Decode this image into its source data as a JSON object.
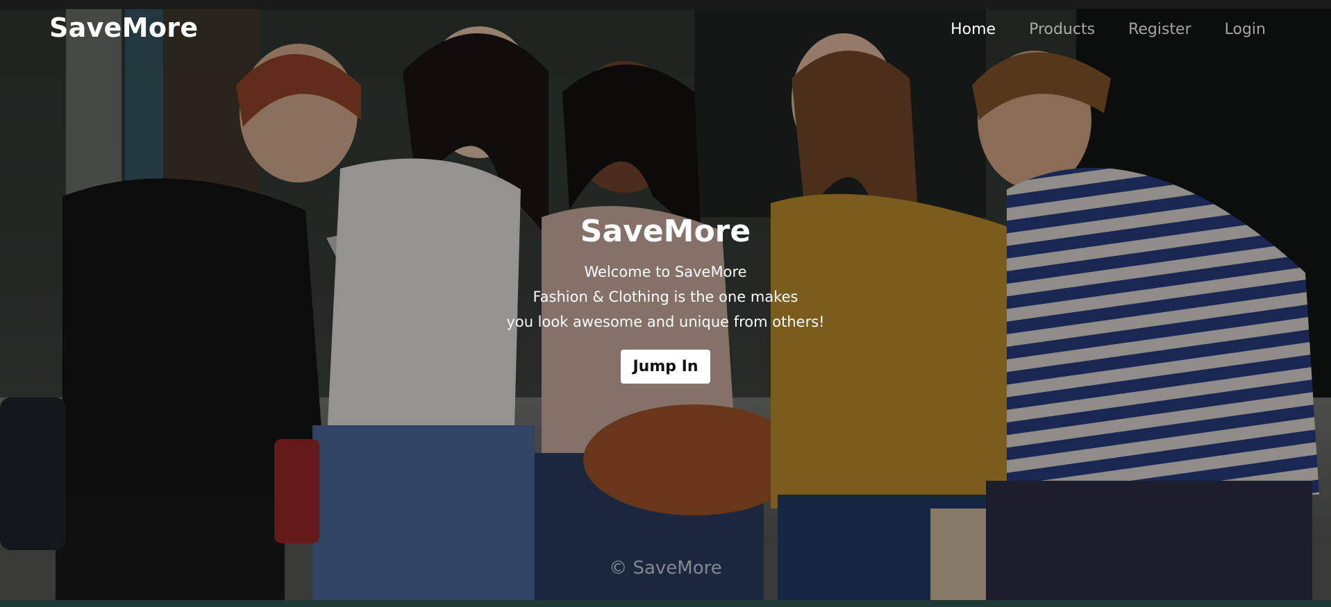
{
  "nav": {
    "brand": "SaveMore",
    "links": [
      {
        "label": "Home",
        "active": true
      },
      {
        "label": "Products",
        "active": false
      },
      {
        "label": "Register",
        "active": false
      },
      {
        "label": "Login",
        "active": false
      }
    ]
  },
  "hero": {
    "title": "SaveMore",
    "lines": [
      "Welcome to SaveMore",
      "Fashion & Clothing is the one makes",
      "you look awesome and unique from others!"
    ],
    "cta_label": "Jump In"
  },
  "footer": {
    "copyright": "© SaveMore"
  }
}
